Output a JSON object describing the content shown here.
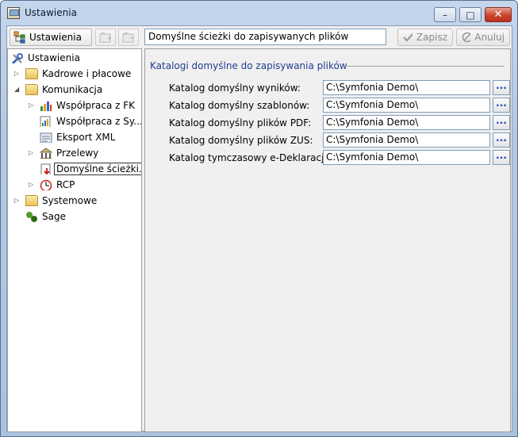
{
  "window": {
    "title": "Ustawienia",
    "minimize_glyph": "–",
    "maximize_glyph": "□",
    "close_glyph": "✕"
  },
  "toolbar": {
    "settings_label": "Ustawienia",
    "path": "Domyślne ścieżki do zapisywanych plików",
    "save_label": "Zapisz",
    "cancel_label": "Anuluj"
  },
  "tree": {
    "root": "Ustawienia",
    "items": [
      {
        "label": "Kadrowe i płacowe"
      },
      {
        "label": "Komunikacja"
      },
      {
        "label": "Współpraca z FK"
      },
      {
        "label": "Współpraca z Sy..."
      },
      {
        "label": "Eksport XML"
      },
      {
        "label": "Przelewy"
      },
      {
        "label": "Domyślne ścieżki..."
      },
      {
        "label": "RCP"
      },
      {
        "label": "Systemowe"
      },
      {
        "label": "Sage"
      }
    ]
  },
  "content": {
    "group_title": "Katalogi domyślne do zapisywania plików",
    "browse_label": "...",
    "rows": [
      {
        "label": "Katalog domyślny wyników:",
        "value": "C:\\Symfonia Demo\\"
      },
      {
        "label": "Katalog domyślny szablonów:",
        "value": "C:\\Symfonia Demo\\"
      },
      {
        "label": "Katalog domyślny plików PDF:",
        "value": "C:\\Symfonia Demo\\"
      },
      {
        "label": "Katalog domyślny plików ZUS:",
        "value": "C:\\Symfonia Demo\\"
      },
      {
        "label": "Katalog tymczasowy e-Deklaracji:",
        "value": "C:\\Symfonia Demo\\"
      }
    ]
  },
  "colors": {
    "group_title": "#1e3d8f",
    "browse_button_text": "#1a3fb0"
  }
}
